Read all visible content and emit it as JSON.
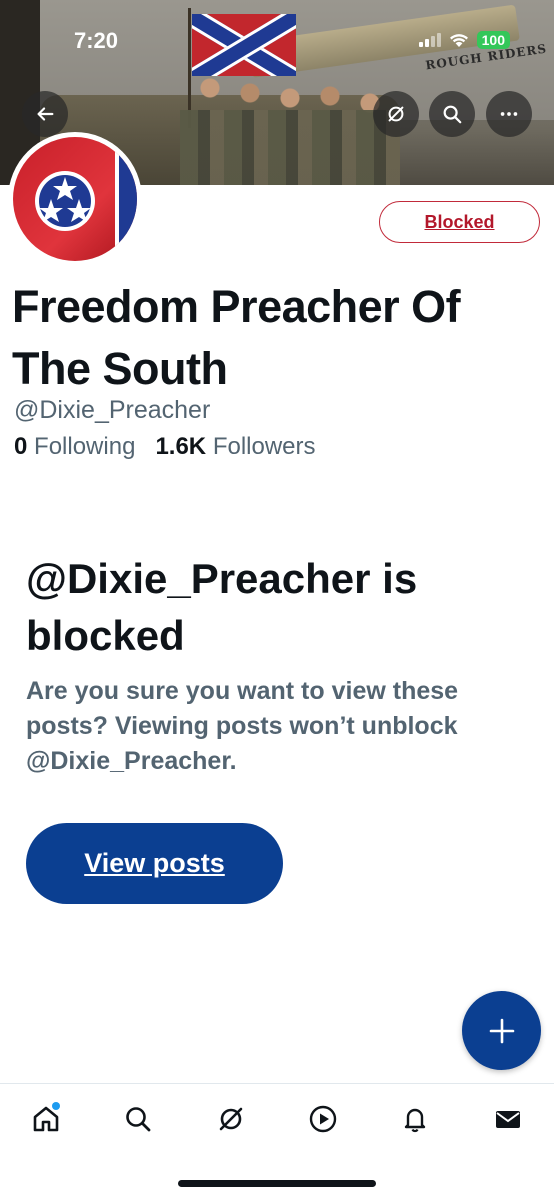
{
  "status_bar": {
    "time": "7:20",
    "battery": "100"
  },
  "banner": {
    "barrel_text": "ROUGH RIDERS"
  },
  "profile": {
    "blocked_label": "Blocked",
    "display_name": "Freedom Preacher Of The South",
    "handle": "@Dixie_Preacher",
    "following_count": "0",
    "following_label": "Following",
    "followers_count": "1.6K",
    "followers_label": "Followers"
  },
  "blocked_notice": {
    "title": "@Dixie_Preacher is blocked",
    "description": "Are you sure you want to view these posts? Viewing posts won’t unblock @Dixie_Preacher.",
    "view_posts_label": "View posts"
  },
  "icons": {
    "header": [
      "back-arrow-icon",
      "grok-icon",
      "search-icon",
      "more-icon"
    ],
    "fab": "plus-icon",
    "nav": [
      "home-icon",
      "search-icon",
      "grok-icon",
      "video-icon",
      "notifications-icon",
      "messages-icon"
    ]
  },
  "colors": {
    "accent": "#0b3f91",
    "blocked_red": "#b3182b",
    "secondary_text": "#536471",
    "notification_dot": "#1d9bf0"
  }
}
